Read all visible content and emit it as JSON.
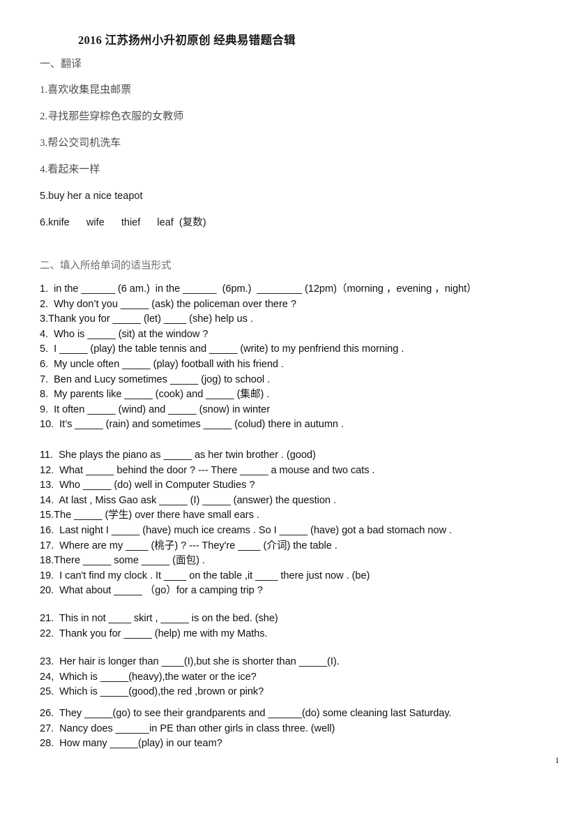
{
  "document": {
    "title": "2016 江苏扬州小升初原创  经典易错题合辑",
    "page_number": "1"
  },
  "sections": {
    "translation": {
      "heading": "一、翻译",
      "items": [
        {
          "text": "1.喜欢收集昆虫邮票",
          "script": "cjk"
        },
        {
          "text": "2.寻找那些穿棕色衣服的女教师",
          "script": "cjk"
        },
        {
          "text": "3.帮公交司机洗车",
          "script": "cjk"
        },
        {
          "text": "4.看起来一样",
          "script": "cjk"
        },
        {
          "text": "5.buy her a nice teapot",
          "script": "latin"
        },
        {
          "text": "6.knife      wife      thief      leaf  (复数)",
          "script": "latin"
        }
      ]
    },
    "fill_in_the_blank": {
      "heading": "二、填入所给单词的适当形式",
      "group_a": [
        "1.  in the ______ (6 am.)  in the ______  (6pm.)  ________ (12pm)（morning ，evening ，night）",
        "2.  Why don’t you _____ (ask) the policeman over there ?",
        "3.Thank you for _____ (let) ____ (she) help us .",
        "4.  Who is _____ (sit) at the window ?",
        "5.  I _____ (play) the table tennis and _____ (write) to my penfriend this morning .",
        "6.  My uncle often _____ (play) football with his friend .",
        "7.  Ben and Lucy sometimes _____ (jog) to school .",
        "8.  My parents like _____ (cook) and _____ (集邮) .",
        "9.  It often _____ (wind) and _____ (snow) in winter",
        "10.  It’s _____ (rain) and sometimes _____ (colud) there in autumn ."
      ],
      "group_b": [
        "11.  She plays the piano as _____ as her twin brother . (good)",
        "12.  What _____ behind the door ? --- There _____ a mouse and two cats .",
        "13.  Who _____ (do) well in Computer Studies ?",
        "14.  At last , Miss Gao ask _____ (I) _____ (answer) the question .",
        "15.The _____ (学生) over there have small ears .",
        "16.  Last night I _____ (have) much ice creams . So I _____ (have) got a bad stomach now .",
        "17.  Where are my ____ (桃子) ? --- They're ____ (介词) the table .",
        "18.There _____ some _____ (面包) .",
        "19.  I can't find my clock . It ____ on the table ,it ____ there just now . (be)",
        "20.  What about _____ （go）for a camping trip ?"
      ],
      "group_c": [
        "21.  This in not ____ skirt , _____ is on the bed. (she)",
        "22.  Thank you for _____ (help) me with my Maths."
      ],
      "group_d": [
        "23.  Her hair is longer than ____(I),but she is shorter than _____(I).",
        "24,  Which is _____(heavy),the water or the ice?",
        "25.  Which is _____(good),the red ,brown or pink?"
      ],
      "group_e": [
        "26.  They _____(go) to see their grandparents and ______(do) some cleaning last Saturday.",
        "27.  Nancy does ______in PE than other girls in class three. (well)",
        "28.  How many _____(play) in our team?"
      ]
    }
  }
}
